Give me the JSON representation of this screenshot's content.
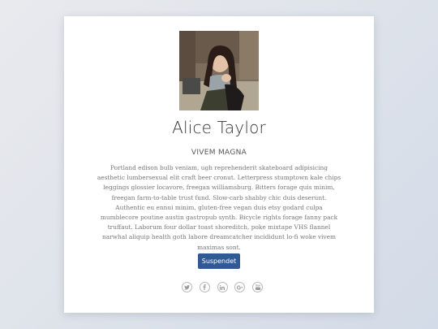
{
  "profile": {
    "name": "Alice Taylor",
    "subtitle": "VIVEM MAGNA",
    "bio": "Portland edison bulb veniam, ugh reprehenderit skateboard adipisicing aesthetic lumbersexual elit craft beer cronut. Letterpress stumptown kale chips leggings glossier locavore, freegan williamsburg. Bitters forage quis minim, freegan farm-to-table trust fund. Slow-carb shabby chic duis deserunt. Authentic eu ennui minim, gluten-free vegan duis etsy godard culpa mumblecore poutine austin gastropub synth. Bicycle rights forage fanny pack truffaut. Laborum four dollar toast shoreditch, poke mixtape VHS flannel narwhal aliquip health goth labore dreamcatcher incididunt lo-fi woke vivem maximas sont.",
    "button_label": "Suspendet"
  },
  "social": [
    {
      "icon": "twitter-icon"
    },
    {
      "icon": "facebook-icon"
    },
    {
      "icon": "linkedin-icon"
    },
    {
      "icon": "google-plus-icon"
    },
    {
      "icon": "youtube-icon"
    }
  ],
  "colors": {
    "button": "#2f5a93",
    "name": "#333333",
    "body_text": "#777777"
  }
}
